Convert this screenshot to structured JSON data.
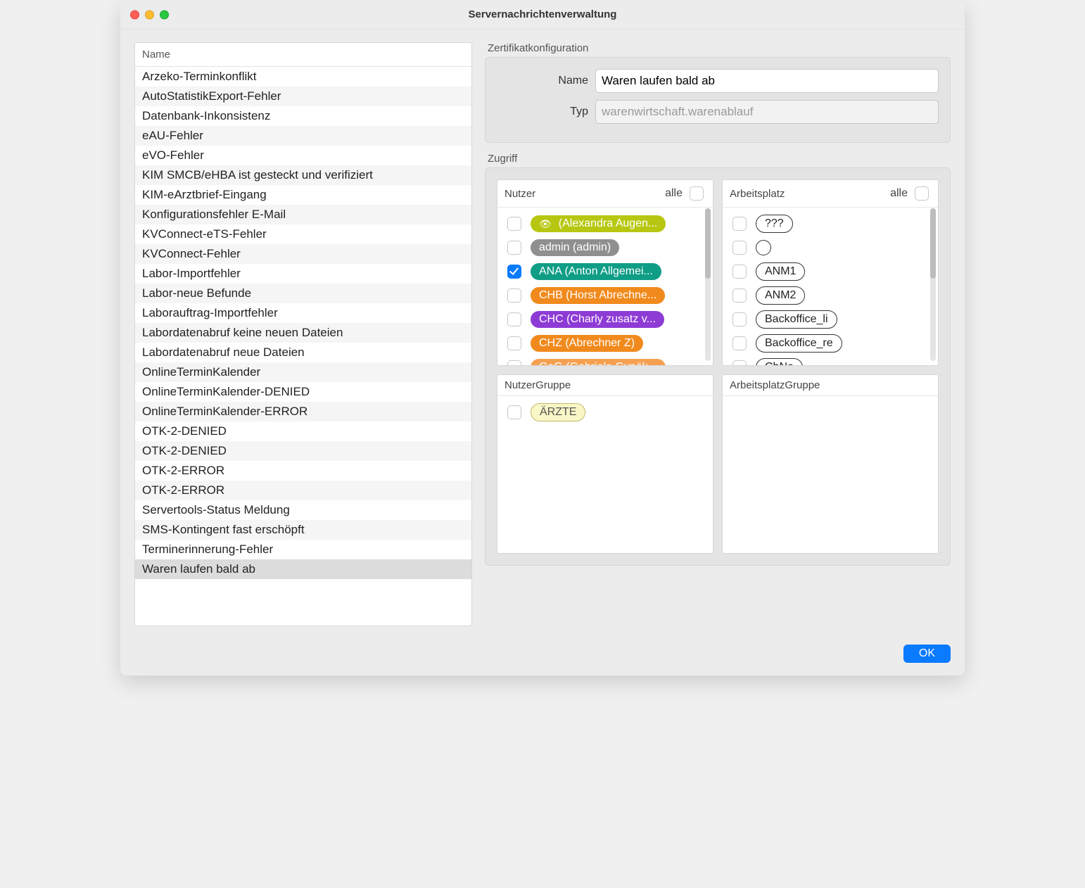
{
  "window": {
    "title": "Servernachrichtenverwaltung"
  },
  "list": {
    "header": "Name",
    "selected_index": 25,
    "items": [
      "Arzeko-Terminkonflikt",
      "AutoStatistikExport-Fehler",
      "Datenbank-Inkonsistenz",
      "eAU-Fehler",
      "eVO-Fehler",
      "KIM SMCB/eHBA ist gesteckt und verifiziert",
      "KIM-eArztbrief-Eingang",
      "Konfigurationsfehler E-Mail",
      "KVConnect-eTS-Fehler",
      "KVConnect-Fehler",
      "Labor-Importfehler",
      "Labor-neue Befunde",
      "Laborauftrag-Importfehler",
      "Labordatenabruf keine neuen Dateien",
      "Labordatenabruf neue Dateien",
      "OnlineTerminKalender",
      "OnlineTerminKalender-DENIED",
      "OnlineTerminKalender-ERROR",
      "OTK-2-DENIED",
      "OTK-2-DENIED",
      "OTK-2-ERROR",
      "OTK-2-ERROR",
      "Servertools-Status Meldung",
      "SMS-Kontingent fast erschöpft",
      "Terminerinnerung-Fehler",
      "Waren laufen bald ab"
    ]
  },
  "cert": {
    "section": "Zertifikatkonfiguration",
    "name_label": "Name",
    "name_value": "Waren laufen bald ab",
    "type_label": "Typ",
    "type_value": "warenwirtschaft.warenablauf"
  },
  "access": {
    "section": "Zugriff",
    "user": {
      "title": "Nutzer",
      "all_label": "alle",
      "all_checked": false,
      "items": [
        {
          "label": "(Alexandra Augen...",
          "color": "#b7c711",
          "icon": "eye",
          "checked": false
        },
        {
          "label": "admin (admin)",
          "color": "#8f8f8f",
          "checked": false
        },
        {
          "label": "ANA (Anton Allgemei...",
          "color": "#0f9d86",
          "checked": true
        },
        {
          "label": "CHB (Horst Abrechne...",
          "color": "#f18a1d",
          "checked": false
        },
        {
          "label": "CHC (Charly zusatz v...",
          "color": "#8e3bd6",
          "checked": false
        },
        {
          "label": "CHZ (Abrechner Z)",
          "color": "#f18a1d",
          "checked": false
        },
        {
          "label": "GaG (Gabriele Gynäk...",
          "color": "#f5a050",
          "checked": false
        }
      ]
    },
    "workstation": {
      "title": "Arbeitsplatz",
      "all_label": "alle",
      "all_checked": false,
      "items": [
        {
          "label": "???",
          "checked": false
        },
        {
          "label": "",
          "checked": false
        },
        {
          "label": "ANM1",
          "checked": false
        },
        {
          "label": "ANM2",
          "checked": false
        },
        {
          "label": "Backoffice_li",
          "checked": false
        },
        {
          "label": "Backoffice_re",
          "checked": false
        },
        {
          "label": "ChNe",
          "checked": false
        }
      ]
    },
    "user_group": {
      "title": "NutzerGruppe",
      "items": [
        {
          "label": "ÄRZTE",
          "bg": "#f9f6c7",
          "fg": "#555",
          "border": "#bfb96a",
          "checked": false
        }
      ]
    },
    "workstation_group": {
      "title": "ArbeitsplatzGruppe",
      "items": []
    }
  },
  "footer": {
    "ok": "OK"
  }
}
